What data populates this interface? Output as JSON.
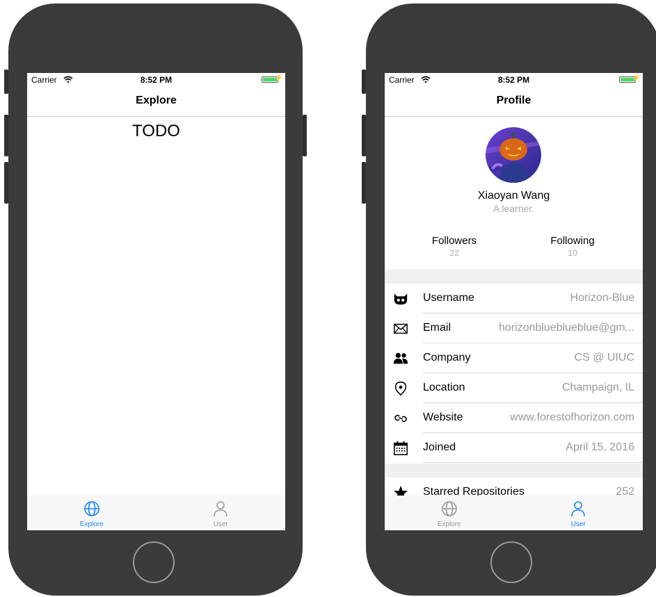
{
  "left_phone": {
    "status": {
      "carrier": "Carrier",
      "time": "8:52 PM"
    },
    "nav_title": "Explore",
    "content_text": "TODO",
    "tabs": [
      {
        "label": "Explore",
        "icon": "globe-icon",
        "active": true
      },
      {
        "label": "User",
        "icon": "user-icon",
        "active": false
      }
    ]
  },
  "right_phone": {
    "status": {
      "carrier": "Carrier",
      "time": "8:52 PM"
    },
    "nav_title": "Profile",
    "profile": {
      "name": "Xiaoyan Wang",
      "bio": "A learner.",
      "followers_label": "Followers",
      "followers_count": "22",
      "following_label": "Following",
      "following_count": "10"
    },
    "details": [
      {
        "icon": "octocat-icon",
        "label": "Username",
        "value": "Horizon-Blue"
      },
      {
        "icon": "mail-icon",
        "label": "Email",
        "value": "horizonblueblueblue@gm..."
      },
      {
        "icon": "people-icon",
        "label": "Company",
        "value": "CS @ UIUC"
      },
      {
        "icon": "location-pin-icon",
        "label": "Location",
        "value": "Champaign, IL"
      },
      {
        "icon": "link-icon",
        "label": "Website",
        "value": "www.forestofhorizon.com"
      },
      {
        "icon": "calendar-icon",
        "label": "Joined",
        "value": "April 15, 2016"
      }
    ],
    "starred": {
      "icon": "star-icon",
      "label": "Starred Repositories",
      "value": "252"
    },
    "tabs": [
      {
        "label": "Explore",
        "icon": "globe-icon",
        "active": false
      },
      {
        "label": "User",
        "icon": "user-icon",
        "active": true
      }
    ]
  },
  "colors": {
    "accent": "#1a86f2",
    "inactive": "#999999",
    "phone_body": "#3b3b3b",
    "battery": "#4cd964"
  }
}
